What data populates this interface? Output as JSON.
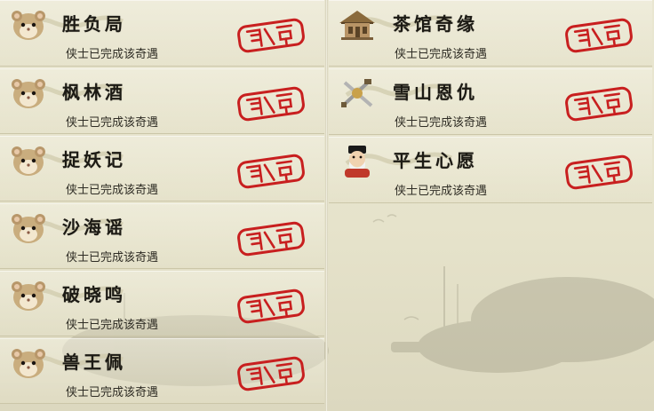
{
  "left_column": [
    {
      "title": "胜负局",
      "status": "侠士已完成该奇遇",
      "icon": "hamster-icon",
      "stamp": "completed-seal"
    },
    {
      "title": "枫林酒",
      "status": "侠士已完成该奇遇",
      "icon": "hamster-icon",
      "stamp": "completed-seal"
    },
    {
      "title": "捉妖记",
      "status": "侠士已完成该奇遇",
      "icon": "hamster-icon",
      "stamp": "completed-seal"
    },
    {
      "title": "沙海谣",
      "status": "侠士已完成该奇遇",
      "icon": "hamster-icon",
      "stamp": "completed-seal"
    },
    {
      "title": "破晓鸣",
      "status": "侠士已完成该奇遇",
      "icon": "hamster-icon",
      "stamp": "completed-seal"
    },
    {
      "title": "兽王佩",
      "status": "侠士已完成该奇遇",
      "icon": "hamster-icon",
      "stamp": "completed-seal"
    }
  ],
  "right_column": [
    {
      "title": "茶馆奇缘",
      "status": "侠士已完成该奇遇",
      "icon": "teahouse-icon",
      "stamp": "completed-seal"
    },
    {
      "title": "雪山恩仇",
      "status": "侠士已完成该奇遇",
      "icon": "crossed-weapons-icon",
      "stamp": "completed-seal"
    },
    {
      "title": "平生心愿",
      "status": "侠士已完成该奇遇",
      "icon": "bearded-scholar-icon",
      "stamp": "completed-seal"
    }
  ],
  "colors": {
    "background": "#e6e3cb",
    "stamp_red": "#c81f1f",
    "title_text": "#1c1a14",
    "status_text": "#2f2d25"
  }
}
